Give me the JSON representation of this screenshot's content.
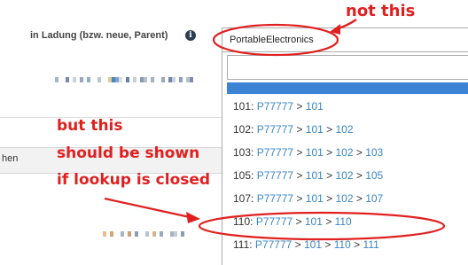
{
  "form": {
    "field_label": "in Ladung (bzw. neue, Parent)",
    "info_icon": "i",
    "row_label": "hen"
  },
  "select": {
    "value": "PortableElectronics",
    "search_value": ""
  },
  "dropdown": {
    "items": [
      {
        "code": "101:",
        "path": [
          "P77777",
          "101"
        ]
      },
      {
        "code": "102:",
        "path": [
          "P77777",
          "101",
          "102"
        ]
      },
      {
        "code": "103:",
        "path": [
          "P77777",
          "101",
          "102",
          "103"
        ]
      },
      {
        "code": "105:",
        "path": [
          "P77777",
          "101",
          "102",
          "105"
        ]
      },
      {
        "code": "107:",
        "path": [
          "P77777",
          "101",
          "102",
          "107"
        ]
      },
      {
        "code": "110:",
        "path": [
          "P77777",
          "101",
          "110"
        ]
      },
      {
        "code": "111:",
        "path": [
          "P77777",
          "101",
          "110",
          "111"
        ]
      }
    ]
  },
  "annotations": {
    "top": "not this",
    "left_lines": [
      "but this",
      "should be shown",
      "if lookup is closed"
    ],
    "color": "#e02020"
  },
  "colors": {
    "highlight": "#3c83d4",
    "link": "#3a86c5"
  }
}
